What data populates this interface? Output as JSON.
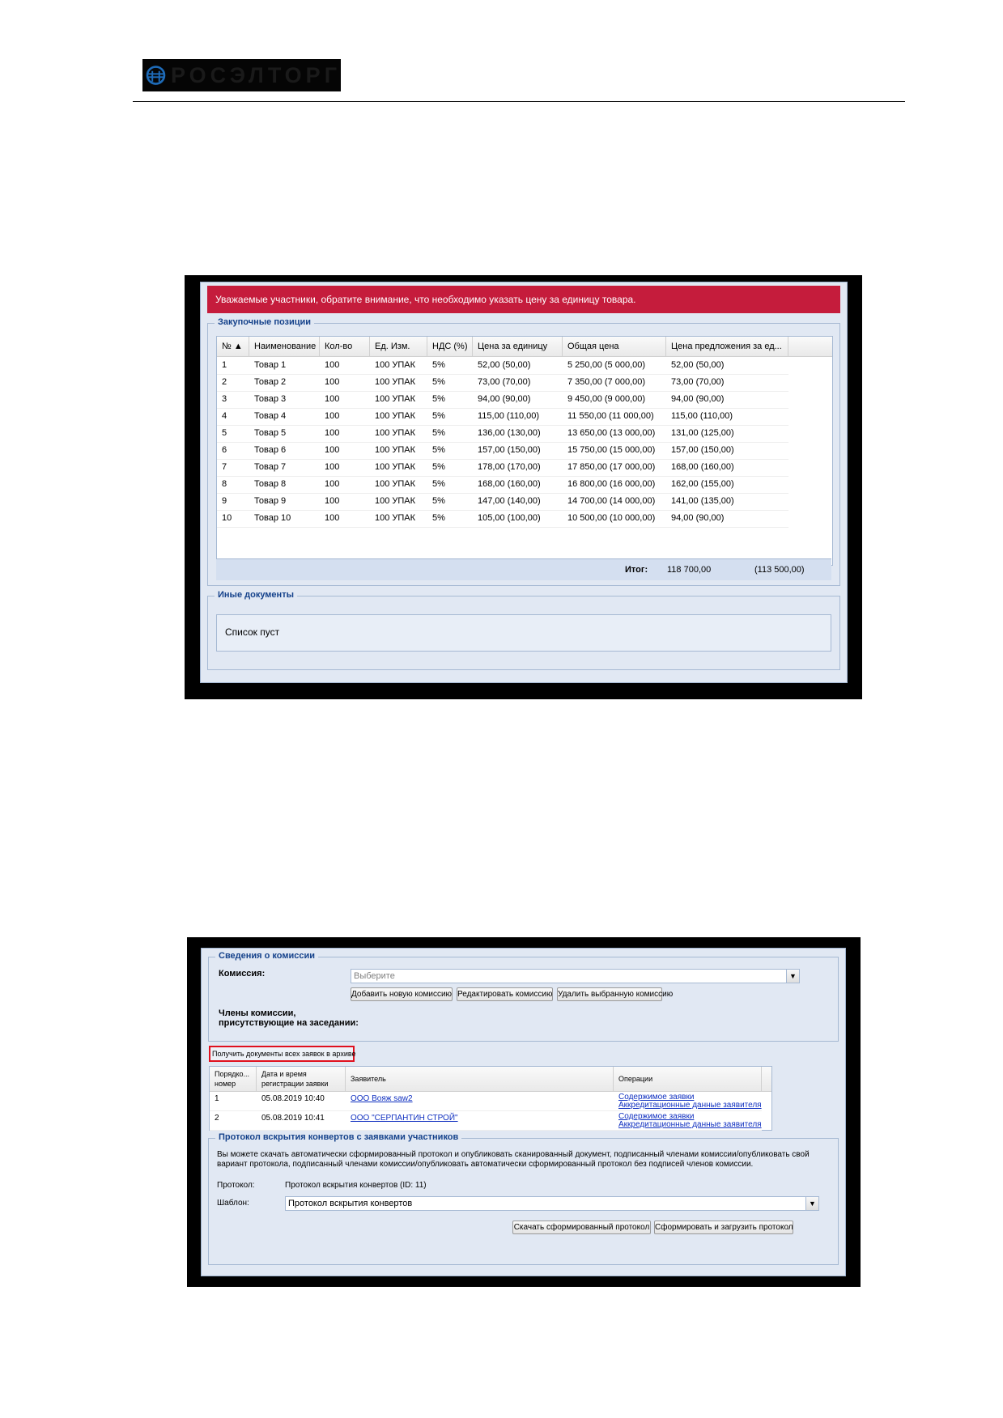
{
  "header": {
    "logo_alt": "РОСЭЛТОРГ"
  },
  "shot1": {
    "alert": "Уважаемые участники, обратите внимание, что необходимо указать цену за единицу товара.",
    "positions_legend": "Закупочные позиции",
    "columns": [
      "№ ▲",
      "Наименование",
      "Кол-во",
      "Ед. Изм.",
      "НДС (%)",
      "Цена за единицу",
      "Общая цена",
      "Цена предложения за ед..."
    ],
    "rows": [
      [
        "1",
        "Товар 1",
        "100",
        "100 УПАК",
        "5%",
        "52,00 (50,00)",
        "5 250,00 (5 000,00)",
        "52,00 (50,00)"
      ],
      [
        "2",
        "Товар 2",
        "100",
        "100 УПАК",
        "5%",
        "73,00 (70,00)",
        "7 350,00 (7 000,00)",
        "73,00 (70,00)"
      ],
      [
        "3",
        "Товар 3",
        "100",
        "100 УПАК",
        "5%",
        "94,00 (90,00)",
        "9 450,00 (9 000,00)",
        "94,00 (90,00)"
      ],
      [
        "4",
        "Товар 4",
        "100",
        "100 УПАК",
        "5%",
        "115,00 (110,00)",
        "11 550,00 (11 000,00)",
        "115,00 (110,00)"
      ],
      [
        "5",
        "Товар 5",
        "100",
        "100 УПАК",
        "5%",
        "136,00 (130,00)",
        "13 650,00 (13 000,00)",
        "131,00 (125,00)"
      ],
      [
        "6",
        "Товар 6",
        "100",
        "100 УПАК",
        "5%",
        "157,00 (150,00)",
        "15 750,00 (15 000,00)",
        "157,00 (150,00)"
      ],
      [
        "7",
        "Товар 7",
        "100",
        "100 УПАК",
        "5%",
        "178,00 (170,00)",
        "17 850,00 (17 000,00)",
        "168,00 (160,00)"
      ],
      [
        "8",
        "Товар 8",
        "100",
        "100 УПАК",
        "5%",
        "168,00 (160,00)",
        "16 800,00 (16 000,00)",
        "162,00 (155,00)"
      ],
      [
        "9",
        "Товар 9",
        "100",
        "100 УПАК",
        "5%",
        "147,00 (140,00)",
        "14 700,00 (14 000,00)",
        "141,00 (135,00)"
      ],
      [
        "10",
        "Товар 10",
        "100",
        "100 УПАК",
        "5%",
        "105,00 (100,00)",
        "10 500,00 (10 000,00)",
        "94,00 (90,00)"
      ]
    ],
    "total_label": "Итог:",
    "total_value": "118 700,00",
    "total_offer": "(113 500,00)",
    "docs_legend": "Иные документы",
    "docs_empty": "Список пуст"
  },
  "shot2": {
    "commission_legend": "Сведения о комиссии",
    "commission_label": "Комиссия:",
    "commission_placeholder": "Выберите",
    "btn_add": "Добавить новую комиссию",
    "btn_edit": "Редактировать комиссию",
    "btn_delete": "Удалить выбранную комиссию",
    "members_label_1": "Члены комиссии,",
    "members_label_2": "присутствующие на заседании:",
    "archive_button": "Получить документы всех заявок в архиве",
    "columns": [
      "Порядко... номер",
      "Дата и время регистрации заявки",
      "Заявитель",
      "Операции"
    ],
    "col0_l1": "Порядко...",
    "col0_l2": "номер",
    "col1_l1": "Дата и время",
    "col1_l2": "регистрации заявки",
    "col2": "Заявитель",
    "col3": "Операции",
    "apps": [
      {
        "num": "1",
        "date": "05.08.2019 10:40",
        "applicant": "ООО Вояж saw2",
        "op1": "Содержимое заявки",
        "op2": "Аккредитационные данные заявителя"
      },
      {
        "num": "2",
        "date": "05.08.2019 10:41",
        "applicant": "ООО \"СЕРПАНТИН СТРОЙ\"",
        "op1": "Содержимое заявки",
        "op2": "Аккредитационные данные заявителя"
      }
    ],
    "protocol_legend": "Протокол вскрытия конвертов с заявками участников",
    "protocol_text": "Вы можете скачать автоматически сформированный протокол и опубликовать сканированный документ, подписанный членами комиссии/опубликовать свой вариант протокола, подписанный членами комиссии/опубликовать автоматически сформированный протокол без подписей членов комиссии.",
    "protocol_label": "Протокол:",
    "protocol_value": "Протокол вскрытия конвертов (ID: 11)",
    "template_label": "Шаблон:",
    "template_value": "Протокол вскрытия конвертов",
    "btn_download": "Скачать сформированный протокол",
    "btn_generate": "Сформировать и загрузить протокол"
  },
  "colors": {
    "alert_red": "#c51c3c",
    "panel_bg": "#e1e8f3",
    "legend_blue": "#15428b",
    "link_blue": "#1030c0",
    "highlight_red": "#e0101e"
  }
}
